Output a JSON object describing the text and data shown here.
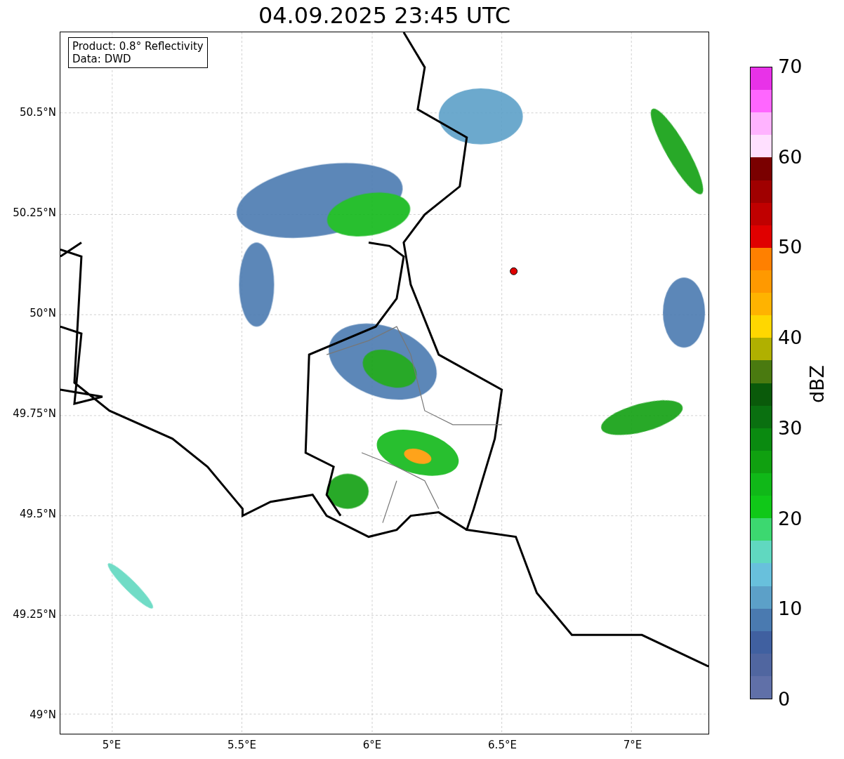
{
  "title": "04.09.2025 23:45 UTC",
  "info_box": {
    "lines": [
      "Product: 0.8° Reflectivity",
      "Data: DWD"
    ]
  },
  "map": {
    "lat_ticks": [
      "50.5°N",
      "50.25°N",
      "50°N",
      "49.75°N",
      "49.5°N",
      "49.25°N",
      "49°N"
    ],
    "lon_ticks": [
      "5°E",
      "5.5°E",
      "6°E",
      "6.5°E",
      "7°E"
    ]
  },
  "colorbar": {
    "label": "dBZ",
    "ticks": [
      "70",
      "60",
      "50",
      "40",
      "30",
      "20",
      "10",
      "0"
    ]
  }
}
